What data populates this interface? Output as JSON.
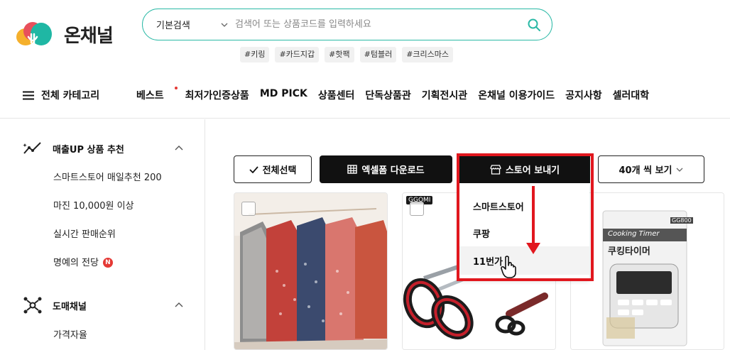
{
  "logo": {
    "text": "온채널"
  },
  "search": {
    "type_label": "기본검색",
    "placeholder": "검색어 또는 상품코드를 입력하세요"
  },
  "tags": [
    "#키링",
    "#카드지갑",
    "#핫팩",
    "#텀블러",
    "#크리스마스"
  ],
  "nav": {
    "all_categories": "전체 카테고리",
    "items": [
      "베스트",
      "최저가인증상품",
      "MD PICK",
      "상품센터",
      "단독상품관",
      "기획전시관",
      "온채널 이용가이드",
      "공지사항",
      "셀러대학"
    ]
  },
  "sidebar": {
    "sec1": {
      "title": "매출UP 상품 추천",
      "items": [
        "스마트스토어 매일추천 200",
        "마진 10,000원 이상",
        "실시간 판매순위",
        "명예의 전당"
      ],
      "badge": "N"
    },
    "sec2": {
      "title": "도매채널",
      "items": [
        "가격자율"
      ]
    }
  },
  "toolbar": {
    "select_all": "전체선택",
    "excel": "엑셀폼 다운로드",
    "store_send": "스토어 보내기",
    "per_page": "40개 씩 보기"
  },
  "dropdown": {
    "items": [
      "스마트스토어",
      "쿠팡",
      "11번가"
    ]
  },
  "products": {
    "brand": "GGOMI",
    "timer_brand": "Cooking Timer",
    "timer_name": "쿠킹타이머",
    "timer_code": "GG800"
  },
  "colors": {
    "accent": "#2bb9a6",
    "highlight": "#e1171e",
    "badge": "#e53935"
  }
}
